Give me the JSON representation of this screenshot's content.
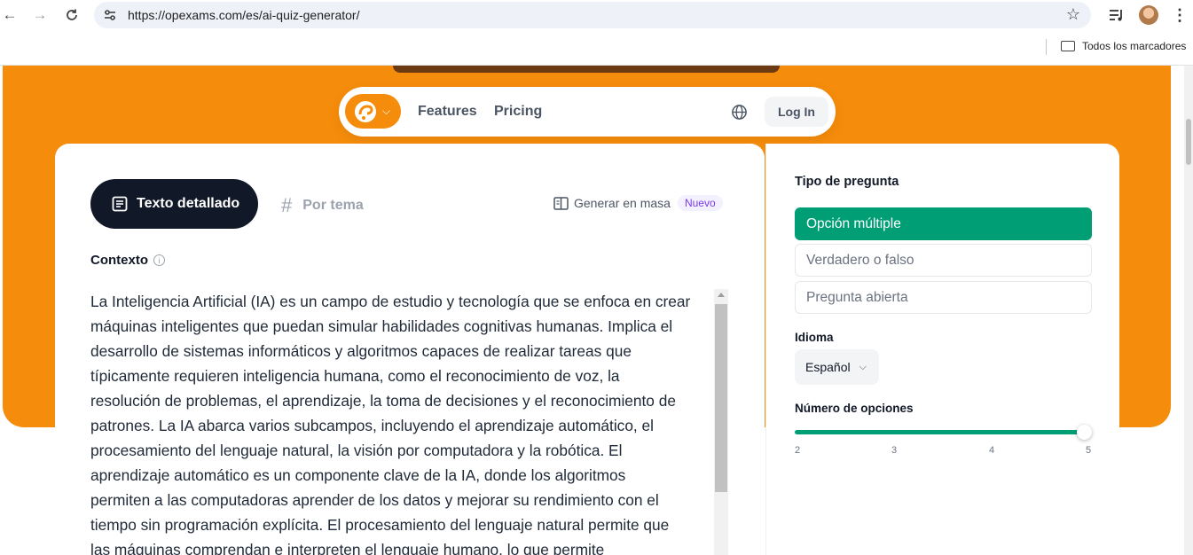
{
  "browser": {
    "url": "https://opexams.com/es/ai-quiz-generator/",
    "bookmarks_folder": "Todos los marcadores"
  },
  "nav": {
    "links": [
      "Features",
      "Pricing"
    ],
    "login": "Log In"
  },
  "tabs": {
    "active": "Texto detallado",
    "inactive": "Por tema",
    "bulk": "Generar en masa",
    "bulk_badge": "Nuevo"
  },
  "context": {
    "label": "Contexto",
    "lines": [
      "La Inteligencia Artificial (IA) es un campo de estudio y tecnología que se enfoca en crear",
      "máquinas inteligentes que puedan simular habilidades cognitivas humanas. Implica el",
      "desarrollo de sistemas informáticos y algoritmos capaces de realizar tareas que",
      "típicamente requieren inteligencia humana, como el reconocimiento de voz, la",
      "resolución de problemas, el aprendizaje, la toma de decisiones y el reconocimiento de",
      "patrones. La IA abarca varios subcampos, incluyendo el aprendizaje automático, el",
      "procesamiento del lenguaje natural, la visión por computadora y la robótica. El",
      "aprendizaje automático es un componente clave de la IA, donde los algoritmos",
      "permiten a las computadoras aprender de los datos y mejorar su rendimiento con el",
      "tiempo sin programación explícita. El procesamiento del lenguaje natural permite que",
      "las máquinas comprendan e interpreten el lenguaje humano, lo que permite"
    ]
  },
  "settings": {
    "question_type_title": "Tipo de pregunta",
    "question_types": [
      "Opción múltiple",
      "Verdadero o falso",
      "Pregunta abierta"
    ],
    "selected_question_type": "Opción múltiple",
    "language_title": "Idioma",
    "language_value": "Español",
    "options_title": "Número de opciones",
    "options_ticks": [
      "2",
      "3",
      "4",
      "5"
    ],
    "options_value": 5
  },
  "colors": {
    "brand_orange": "#f68c0b",
    "accent_green": "#009e74",
    "dark": "#111827"
  }
}
